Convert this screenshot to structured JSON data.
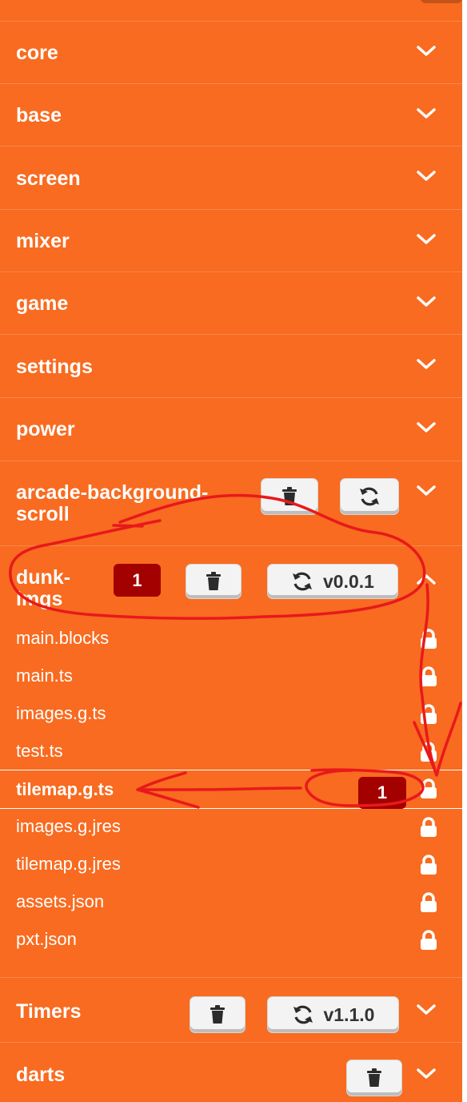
{
  "colors": {
    "background": "#f86b20",
    "row_divider": "#f9874a",
    "button_bg": "#f3f3f3",
    "badge_bg": "#a30000",
    "annotation_red": "#e8191b"
  },
  "packages": {
    "core": {
      "name": "core",
      "icon": "chevron-down-icon"
    },
    "base": {
      "name": "base",
      "icon": "chevron-down-icon"
    },
    "screen": {
      "name": "screen",
      "icon": "chevron-down-icon"
    },
    "mixer": {
      "name": "mixer",
      "icon": "chevron-down-icon"
    },
    "game": {
      "name": "game",
      "icon": "chevron-down-icon"
    },
    "settings": {
      "name": "settings",
      "icon": "chevron-down-icon"
    },
    "power": {
      "name": "power",
      "icon": "chevron-down-icon"
    },
    "arcade_background_scroll": {
      "name": "arcade-background-scroll",
      "icon": "chevron-down-icon",
      "delete_icon": "trash-icon",
      "refresh_icon": "refresh-icon"
    },
    "dunk_imgs": {
      "name": "dunk-imgs",
      "error_count": "1",
      "version": "v0.0.1",
      "icon": "chevron-up-icon",
      "files": [
        {
          "name": "main.blocks",
          "icon": "lock-icon"
        },
        {
          "name": "main.ts",
          "icon": "lock-icon"
        },
        {
          "name": "images.g.ts",
          "icon": "lock-icon"
        },
        {
          "name": "test.ts",
          "icon": "lock-icon"
        },
        {
          "name": "tilemap.g.ts",
          "icon": "lock-icon",
          "error_count": "1",
          "active": true
        },
        {
          "name": "images.g.jres",
          "icon": "lock-icon"
        },
        {
          "name": "tilemap.g.jres",
          "icon": "lock-icon"
        },
        {
          "name": "assets.json",
          "icon": "lock-icon"
        },
        {
          "name": "pxt.json",
          "icon": "lock-icon"
        }
      ]
    },
    "timers": {
      "name": "Timers",
      "version": "v1.1.0",
      "icon": "chevron-down-icon"
    },
    "darts": {
      "name": "darts",
      "icon": "chevron-down-icon"
    }
  }
}
